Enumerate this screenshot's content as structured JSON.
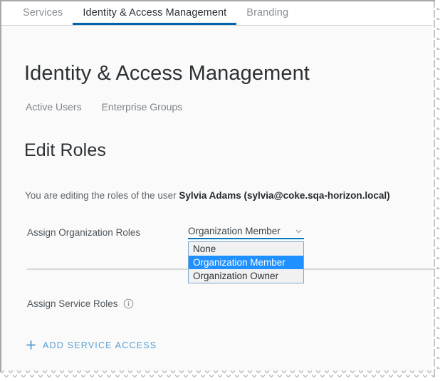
{
  "window": {
    "background": "#fafafa",
    "accent_blue": "#0065ab",
    "highlight_blue": "#1e90ff",
    "link_blue": "#5b9fd0"
  },
  "top_tabs": [
    {
      "label": "Services",
      "active": false
    },
    {
      "label": "Identity & Access Management",
      "active": true
    },
    {
      "label": "Branding",
      "active": false
    }
  ],
  "page": {
    "title": "Identity & Access Management",
    "sub_tabs": [
      {
        "label": "Active Users"
      },
      {
        "label": "Enterprise Groups"
      }
    ],
    "section_title": "Edit Roles",
    "editing_prefix": "You are editing the roles of the user ",
    "editing_user": "Sylvia Adams (sylvia@coke.sqa-horizon.local)"
  },
  "org_roles": {
    "label": "Assign Organization Roles",
    "selected_value": "Organization Member",
    "chevron_icon": "chevron-down-icon",
    "options": [
      {
        "label": "None",
        "selected": false
      },
      {
        "label": "Organization Member",
        "selected": true
      },
      {
        "label": "Organization Owner",
        "selected": false
      }
    ]
  },
  "service_roles": {
    "label": "Assign Service Roles",
    "info_icon": "info-circle-icon",
    "add_button": {
      "icon": "plus-icon",
      "label": "ADD SERVICE ACCESS"
    }
  }
}
